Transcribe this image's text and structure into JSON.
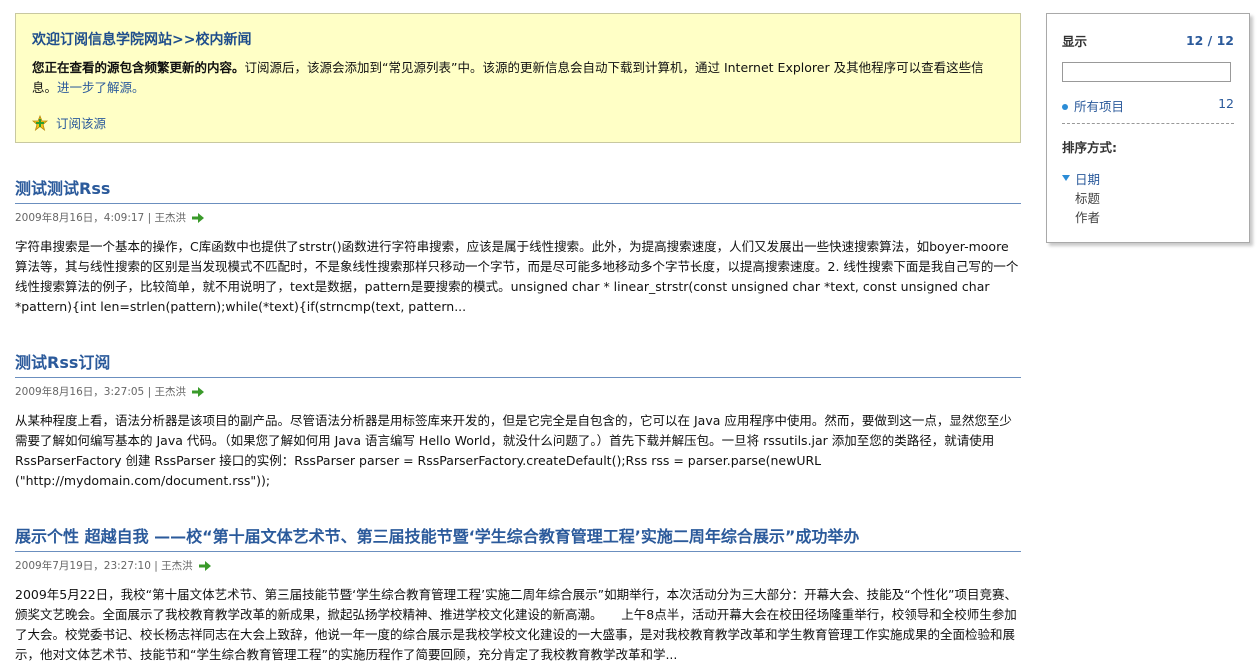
{
  "banner": {
    "title": "欢迎订阅信息学院网站>>校内新闻",
    "bold_text": "您正在查看的源包含频繁更新的内容。",
    "text": "订阅源后，该源会添加到“常见源列表”中。该源的更新信息会自动下载到计算机，通过 Internet Explorer 及其他程序可以查看这些信息。",
    "learn_more": "进一步了解源。",
    "subscribe_label": "订阅该源"
  },
  "items": [
    {
      "title": "测试测试Rss",
      "meta": "2009年8月16日，4:09:17 | 王杰洪",
      "desc": "字符串搜索是一个基本的操作，C库函数中也提供了strstr()函数进行字符串搜索，应该是属于线性搜索。此外，为提高搜索速度，人们又发展出一些快速搜索算法，如boyer-moore算法等，其与线性搜索的区别是当发现模式不匹配时，不是象线性搜索那样只移动一个字节，而是尽可能多地移动多个字节长度，以提高搜索速度。2. 线性搜索下面是我自己写的一个线性搜索算法的例子，比较简单，就不用说明了，text是数据，pattern是要搜索的模式。unsigned char * linear_strstr(const unsigned char *text, const unsigned char *pattern){int len=strlen(pattern);while(*text){if(strncmp(text, pattern..."
    },
    {
      "title": "测试Rss订阅",
      "meta": "2009年8月16日，3:27:05 | 王杰洪",
      "desc": "从某种程度上看，语法分析器是该项目的副产品。尽管语法分析器是用标签库来开发的，但是它完全是自包含的，它可以在 Java 应用程序中使用。然而，要做到这一点，显然您至少需要了解如何编写基本的 Java 代码。（如果您了解如何用 Java 语言编写 Hello World，就没什么问题了。）首先下载并解压包。一旦将 rssutils.jar 添加至您的类路径，就请使用 RssParserFactory 创建 RssParser 接口的实例：RssParser parser = RssParserFactory.createDefault();Rss rss = parser.parse(newURL (\"http://mydomain.com/document.rss\"));"
    },
    {
      "title": "展示个性 超越自我 ——校“第十届文体艺术节、第三届技能节暨‘学生综合教育管理工程’实施二周年综合展示”成功举办",
      "meta": "2009年7月19日，23:27:10 | 王杰洪",
      "desc": " 2009年5月22日，我校“第十届文体艺术节、第三届技能节暨‘学生综合教育管理工程’实施二周年综合展示”如期举行，本次活动分为三大部分：开幕大会、技能及“个性化”项目竞赛、颁奖文艺晚会。全面展示了我校教育教学改革的新成果，掀起弘扬学校精神、推进学校文化建设的新高潮。　　上午8点半，活动开幕大会在校田径场隆重举行，校领导和全校师生参加了大会。校党委书记、校长杨志祥同志在大会上致辞，他说一年一度的综合展示是我校学校文化建设的一大盛事，是对我校教育教学改革和学生教育管理工作实施成果的全面检验和展示，他对文体艺术节、技能节和“学生综合教育管理工程”的实施历程作了简要回顾，充分肯定了我校教育教学改革和学..."
    }
  ],
  "sidebar": {
    "display_label": "显示",
    "display_count": "12 / 12",
    "filter_value": "",
    "all_items_label": "所有项目",
    "all_items_count": "12",
    "sort_title": "排序方式:",
    "sort_options": [
      "日期",
      "标题",
      "作者"
    ]
  },
  "colors": {
    "banner_bg": "#ffffc6",
    "link": "#2b5a9b",
    "accent_arrow": "#3a9a2a"
  },
  "icons": {
    "subscribe": "star-plus-icon",
    "item_go": "green-arrow-icon",
    "sort_active": "triangle-down-icon"
  }
}
